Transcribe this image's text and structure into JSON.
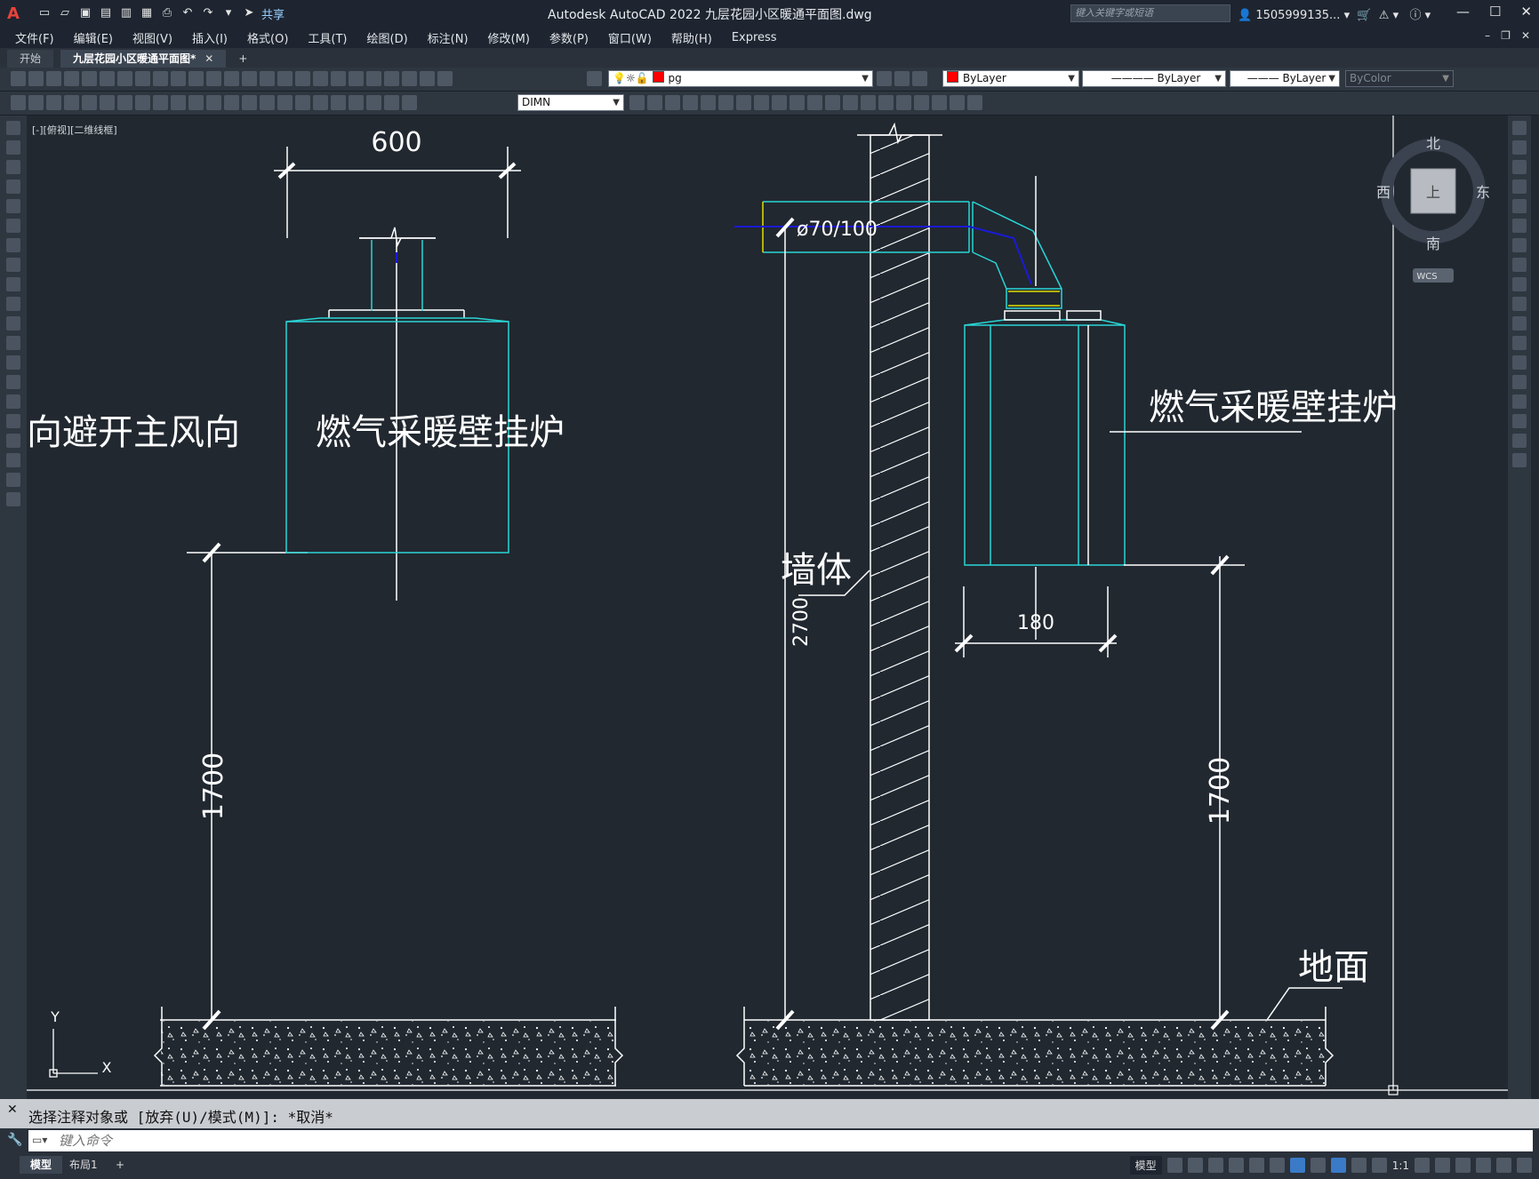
{
  "app": {
    "title": "Autodesk AutoCAD 2022    九层花园小区暖通平面图.dwg",
    "share_label": "共享",
    "search_placeholder": "键入关键字或短语",
    "user_name": "1505999135...",
    "logo": "A"
  },
  "menu": [
    "文件(F)",
    "编辑(E)",
    "视图(V)",
    "插入(I)",
    "格式(O)",
    "工具(T)",
    "绘图(D)",
    "标注(N)",
    "修改(M)",
    "参数(P)",
    "窗口(W)",
    "帮助(H)",
    "Express"
  ],
  "tabs": [
    {
      "label": "开始",
      "active": false
    },
    {
      "label": "九层花园小区暖通平面图*",
      "active": true
    }
  ],
  "toolbar": {
    "layer": "pg",
    "color": "ByLayer",
    "linetype": "ByLayer",
    "lineweight": "ByLayer",
    "plotstyle": "ByColor",
    "dimstyle": "DIMN",
    "layer_color": "#ff0000"
  },
  "viewport": {
    "label": "[-][俯视][二维线框]",
    "compass": {
      "north": "北",
      "south": "南",
      "east": "东",
      "west": "西",
      "face": "上"
    },
    "ucs": "WCS",
    "axis_x": "X",
    "axis_y": "Y"
  },
  "drawing": {
    "left_dim_top": "600",
    "left_dim_height": "1700",
    "left_partial_text": "向避开主风向",
    "left_boiler_label": "燃气采暖壁挂炉",
    "pipe_label": "ø70/100",
    "wall_label": "墙体",
    "dim_2700": "2700",
    "dim_180": "180",
    "right_boiler_label": "燃气采暖壁挂炉",
    "right_dim_height": "1700",
    "ground_label": "地面"
  },
  "command": {
    "history": "选择注释对象或 [放弃(U)/模式(M)]: *取消*",
    "placeholder": "键入命令"
  },
  "status": {
    "layout_tabs": [
      "模型",
      "布局1"
    ],
    "model_label": "模型",
    "scale": "1:1"
  },
  "colors": {
    "background": "#212830",
    "cyan": "#2ad6d6",
    "white": "#ffffff",
    "blue": "#1a1ad8",
    "yellow": "#e0e000"
  }
}
